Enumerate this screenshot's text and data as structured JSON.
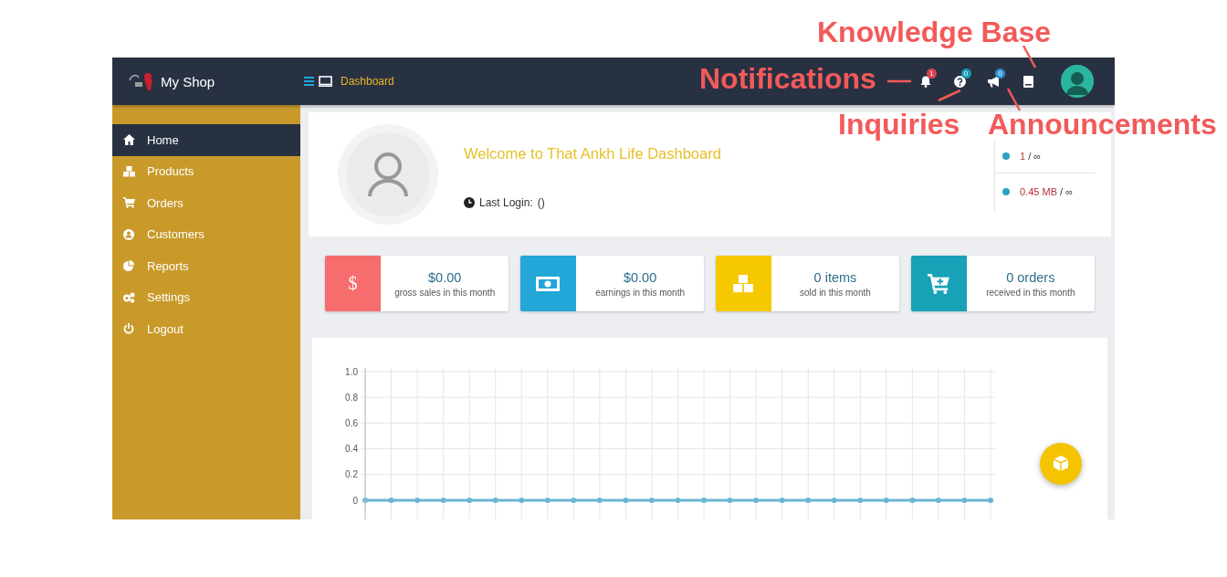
{
  "header": {
    "brand": "My Shop",
    "breadcrumb": "Dashboard",
    "tools": [
      {
        "kind": "bell",
        "count": "1",
        "color": "#d9434e"
      },
      {
        "kind": "question",
        "count": "0",
        "color": "#1a9bb0"
      },
      {
        "kind": "megaphone",
        "count": "0",
        "color": "#2f8fd6"
      },
      {
        "kind": "book"
      }
    ]
  },
  "sidebar": {
    "items": [
      {
        "label": "Home",
        "kind": "home",
        "selected": true
      },
      {
        "label": "Products",
        "kind": "cubes",
        "selected": false
      },
      {
        "label": "Orders",
        "kind": "cart",
        "selected": false
      },
      {
        "label": "Customers",
        "kind": "user",
        "selected": false
      },
      {
        "label": "Reports",
        "kind": "pie",
        "selected": false
      },
      {
        "label": "Settings",
        "kind": "gears",
        "selected": false
      },
      {
        "label": "Logout",
        "kind": "power",
        "selected": false
      }
    ]
  },
  "profile": {
    "welcome": "Welcome to That Ankh Life Dashboard",
    "last_login_label": "Last Login:",
    "last_login_value": "()",
    "usage": [
      {
        "value": "1",
        "rest": "/ ∞"
      },
      {
        "value": "0.45 MB",
        "rest": "/ ∞"
      }
    ]
  },
  "stats": [
    {
      "kind": "dollar",
      "symbol": "$",
      "value": "$0.00",
      "caption": "gross sales in this month",
      "color": "#f76c6c"
    },
    {
      "kind": "money",
      "value": "$0.00",
      "caption": "earnings in this month",
      "color": "#22a7d8"
    },
    {
      "kind": "cubes",
      "value": "0 items",
      "caption": "sold in this month",
      "color": "#f6c800"
    },
    {
      "kind": "cart",
      "value": "0 orders",
      "caption": "received in this month",
      "color": "#17a2b8"
    }
  ],
  "chart": {
    "chart_data": {
      "type": "line",
      "grid": true,
      "ylim": [
        0,
        1
      ],
      "yticks": [
        0,
        0.2,
        0.4,
        0.6,
        0.8,
        {
          "value": 1,
          "label": "1.0"
        }
      ],
      "series": [
        {
          "color": "#6ab7d3",
          "marker": "circle",
          "values": [
            0,
            0,
            0,
            0,
            0,
            0,
            0,
            0,
            0,
            0,
            0,
            0,
            0,
            0,
            0,
            0,
            0,
            0,
            0,
            0,
            0,
            0,
            0,
            0,
            0
          ]
        }
      ]
    }
  },
  "annotations": [
    {
      "kind": "knowledge",
      "text": "Knowledge Base"
    },
    {
      "kind": "notifications",
      "text": "Notifications"
    },
    {
      "kind": "inquiries",
      "text": "Inquiries"
    },
    {
      "kind": "announcements",
      "text": "Announcements"
    }
  ]
}
